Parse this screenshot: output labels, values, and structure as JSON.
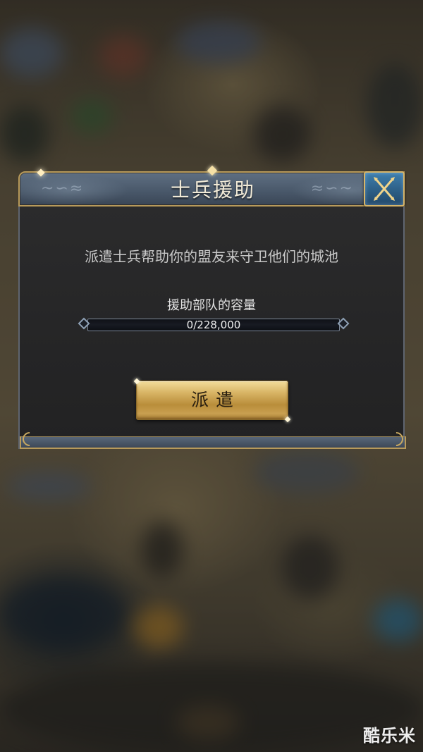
{
  "dialog": {
    "title": "士兵援助",
    "description": "派遣士兵帮助你的盟友来守卫他们的城池",
    "capacity": {
      "label": "援助部队的容量",
      "current": 0,
      "max": 228000,
      "display": "0/228,000"
    },
    "dispatch_button": {
      "label": "派遣"
    },
    "close_button": {
      "icon": "close-icon"
    }
  },
  "watermark": {
    "text": "酷乐米"
  },
  "colors": {
    "gold_trim": "#b89a5a",
    "header_blue": "#4a596b",
    "panel_dark": "#272728",
    "button_gold": "#d8b465",
    "close_blue": "#2d5f86"
  }
}
